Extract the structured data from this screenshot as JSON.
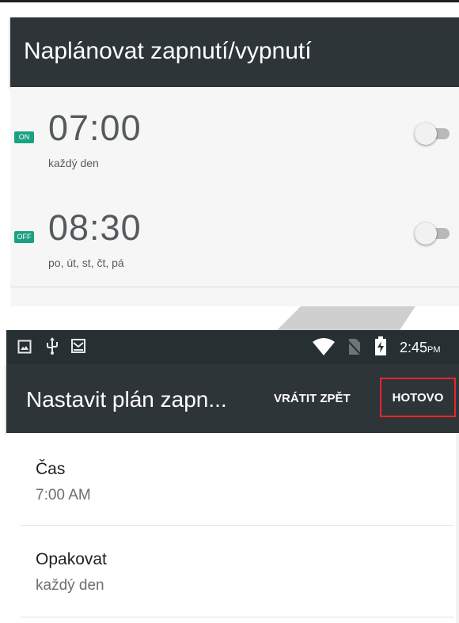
{
  "screen1": {
    "title": "Naplánovat zapnutí/vypnutí",
    "schedules": [
      {
        "badge": "ON",
        "time": "07:00",
        "days": "každý den",
        "enabled": false
      },
      {
        "badge": "OFF",
        "time": "08:30",
        "days": "po, út, st, čt, pá",
        "enabled": false
      }
    ],
    "colors": {
      "header": "#2e3539",
      "badge": "#1aa181"
    }
  },
  "screen2": {
    "status_bar": {
      "left_icons": [
        "image-icon",
        "usb-icon",
        "gallery-icon"
      ],
      "right_icons": [
        "wifi-icon",
        "no-sim-icon",
        "battery-charging-icon"
      ],
      "time": "2:45",
      "ampm": "PM"
    },
    "toolbar": {
      "title": "Nastavit plán zapn...",
      "revert_label": "VRÁTIT ZPĚT",
      "done_label": "HOTOVO",
      "highlight_color": "#e8262b"
    },
    "settings": [
      {
        "label": "Čas",
        "value": "7:00 AM"
      },
      {
        "label": "Opakovat",
        "value": "každý den"
      }
    ]
  }
}
